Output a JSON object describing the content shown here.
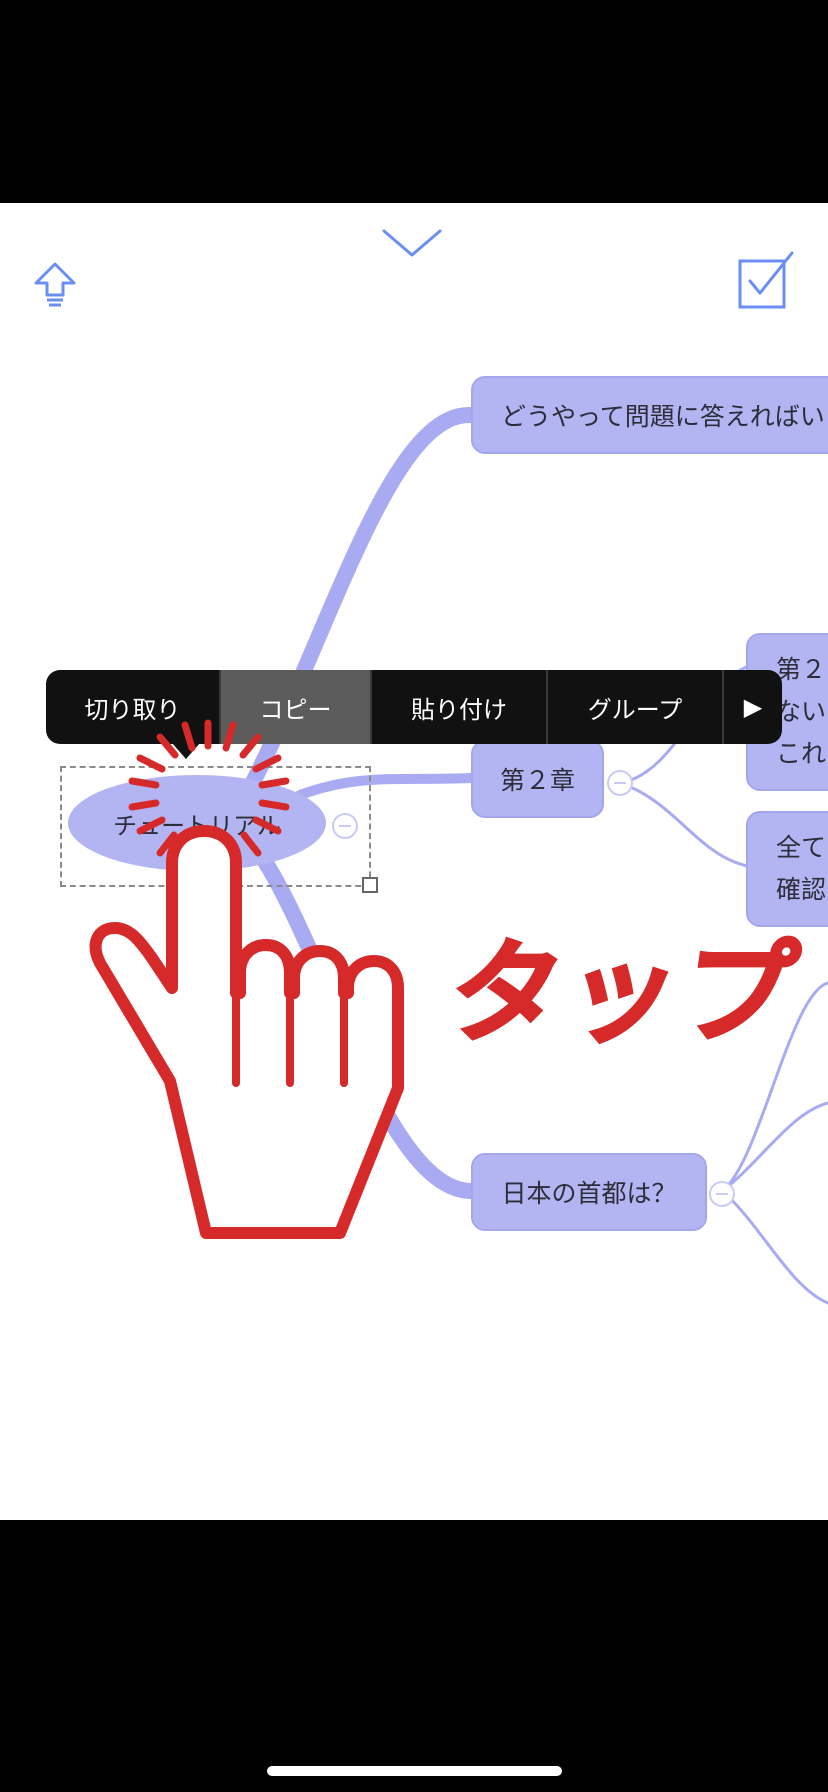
{
  "toolbar": {
    "left_icon": "share-arrow-up-icon",
    "center_icon": "chevron-down-icon",
    "right_icon": "checkbox-icon",
    "accent": "#6b8ef5"
  },
  "mindmap": {
    "root": {
      "label": "チュートリアル"
    },
    "nodes": [
      {
        "label": "どうやって問題に答えればい"
      },
      {
        "label": "第２章"
      },
      {
        "label": "日本の首都は？"
      },
      {
        "lines": [
          "第２",
          "ない",
          "これ"
        ]
      },
      {
        "lines": [
          "全て",
          "確認"
        ]
      }
    ],
    "node_color": "#b3b5f2",
    "branch_color": "#a9abf2"
  },
  "context_menu": {
    "items": [
      {
        "label": "切り取り"
      },
      {
        "label": "コピー",
        "active": true
      },
      {
        "label": "貼り付け"
      },
      {
        "label": "グループ"
      }
    ],
    "more_icon": "▶"
  },
  "annotation": {
    "caption": "タップ",
    "color": "#d62a2a",
    "icon": "tap-hand-icon"
  }
}
